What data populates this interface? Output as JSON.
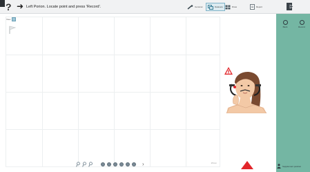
{
  "toolbar": {
    "help_label": "?",
    "instruction": "Left Porion. Locate point and press 'Record'.",
    "tools": [
      {
        "label": "Ceromet",
        "icon": "ruler-icon"
      },
      {
        "label": "Datasets",
        "icon": "layers-icon"
      },
      {
        "label": "Draw",
        "icon": "grid-icon"
      },
      {
        "label": "Report",
        "icon": "document-icon"
      }
    ]
  },
  "plot": {
    "view_label": "View",
    "scale_label": "25mm"
  },
  "right_panel": {
    "buttons": [
      "Back",
      "Record"
    ],
    "footer_label": "Supplement position"
  },
  "colors": {
    "panel": "#74b6a3",
    "accent_red": "#e2262b",
    "toolbar": "#f1f2f3"
  }
}
